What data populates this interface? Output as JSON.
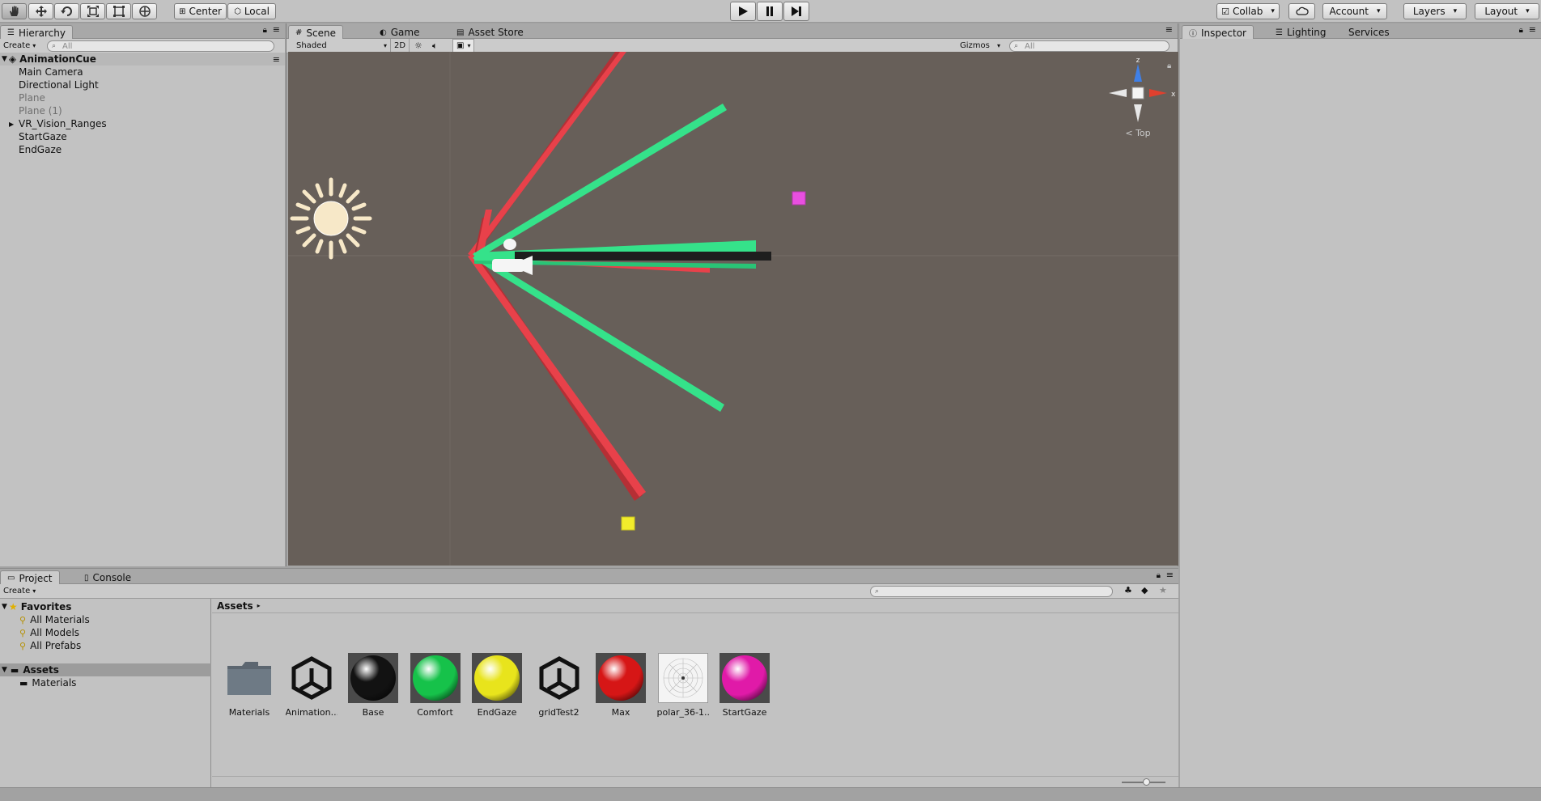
{
  "toolbar": {
    "pivot_label": "Center",
    "space_label": "Local",
    "collab_label": "Collab",
    "account_label": "Account",
    "layers_label": "Layers",
    "layout_label": "Layout"
  },
  "hierarchy": {
    "tab_label": "Hierarchy",
    "create_label": "Create",
    "search_placeholder": "All",
    "scene_name": "AnimationCue",
    "items": [
      {
        "label": "Main Camera",
        "dim": false
      },
      {
        "label": "Directional Light",
        "dim": false
      },
      {
        "label": "Plane",
        "dim": true
      },
      {
        "label": "Plane (1)",
        "dim": true
      },
      {
        "label": "VR_Vision_Ranges",
        "dim": false,
        "expandable": true
      },
      {
        "label": "StartGaze",
        "dim": false
      },
      {
        "label": "EndGaze",
        "dim": false
      }
    ]
  },
  "scene": {
    "tabs": [
      "Scene",
      "Game",
      "Asset Store"
    ],
    "shading_mode": "Shaded",
    "mode_2d": "2D",
    "gizmos_label": "Gizmos",
    "search_placeholder": "All",
    "orientation_label": "Top",
    "axis_labels": {
      "z": "z",
      "x": "x"
    },
    "colors": {
      "background": "#675f59",
      "red_range": "#e8414a",
      "green_range": "#35e28a",
      "start_gaze": "#e84fe0",
      "end_gaze": "#f2ec2b"
    }
  },
  "inspector": {
    "tabs": [
      "Inspector",
      "Lighting",
      "Services"
    ]
  },
  "project": {
    "tabs": [
      "Project",
      "Console"
    ],
    "create_label": "Create",
    "favorites_label": "Favorites",
    "favorites": [
      "All Materials",
      "All Models",
      "All Prefabs"
    ],
    "assets_label": "Assets",
    "asset_folders": [
      "Materials"
    ],
    "breadcrumb": "Assets",
    "assets": [
      {
        "label": "Materials",
        "kind": "folder-icon"
      },
      {
        "label": "Animation...",
        "kind": "unity-icon"
      },
      {
        "label": "Base",
        "kind": "sphere",
        "color": "#121212"
      },
      {
        "label": "Comfort",
        "kind": "sphere",
        "color": "#16c24a"
      },
      {
        "label": "EndGaze",
        "kind": "sphere",
        "color": "#e8e41c"
      },
      {
        "label": "gridTest2",
        "kind": "unity-icon"
      },
      {
        "label": "Max",
        "kind": "sphere",
        "color": "#d61616"
      },
      {
        "label": "polar_36-1...",
        "kind": "texture"
      },
      {
        "label": "StartGaze",
        "kind": "sphere",
        "color": "#e01aa8"
      }
    ]
  }
}
